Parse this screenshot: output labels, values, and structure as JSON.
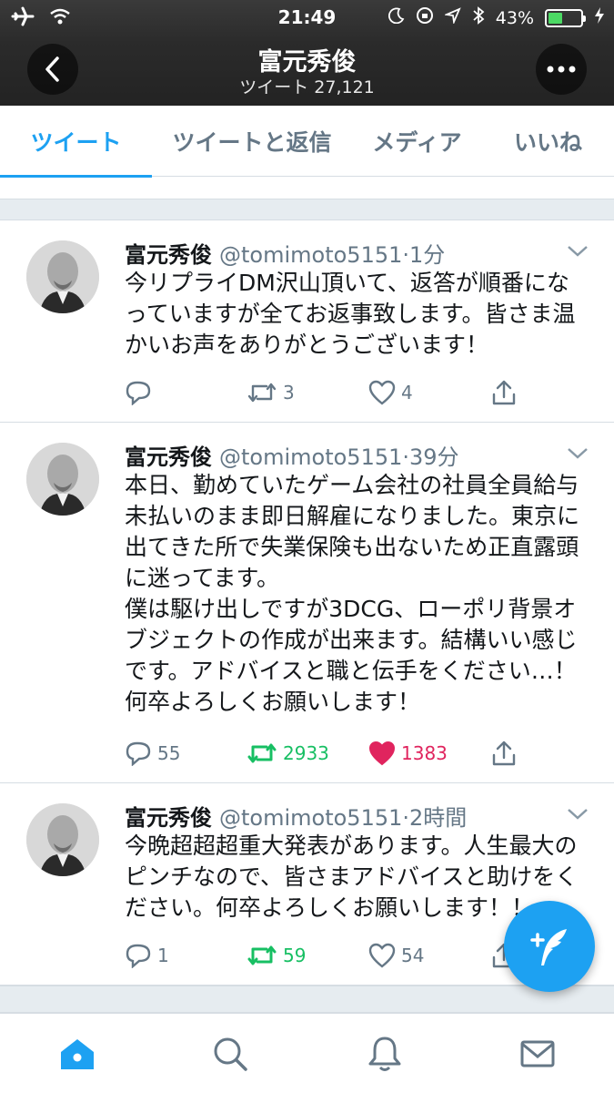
{
  "status_bar": {
    "time": "21:49",
    "battery": "43%",
    "battery_level": 0.43,
    "icons": [
      "airplane-icon",
      "wifi-icon",
      "moon-icon",
      "rotation-lock-icon",
      "location-icon",
      "bluetooth-icon",
      "battery-icon",
      "charging-icon"
    ]
  },
  "header": {
    "name": "富元秀俊",
    "subtitle": "ツイート 27,121",
    "back_icon": "chevron-left-icon",
    "more_icon": "more-dots-icon"
  },
  "tabs": [
    {
      "label": "ツイート",
      "active": true
    },
    {
      "label": "ツイートと返信",
      "active": false
    },
    {
      "label": "メディア",
      "active": false
    },
    {
      "label": "いいね",
      "active": false
    }
  ],
  "tweets": [
    {
      "name": "富元秀俊",
      "handle": "@tomimoto5151",
      "time": "·1分",
      "text": "今リプライDM沢山頂いて、返答が順番にな\nっていますが全てお返事致します。皆さま温\nかいお声をありがとうございます！",
      "replies": "",
      "retweets": "3",
      "likes": "4",
      "retweeted": false,
      "liked": false
    },
    {
      "name": "富元秀俊",
      "handle": "@tomimoto5151",
      "time": "·39分",
      "text": "本日、勤めていたゲーム会社の社員全員給与\n未払いのまま即日解雇になりました。東京に\n出てきた所で失業保険も出ないため正直露頭\nに迷ってます。\n僕は駆け出しですが3DCG、ローポリ背景オ\nブジェクトの作成が出来ます。結構いい感じ\nです。アドバイスと職と伝手をください…！\n何卒よろしくお願いします！",
      "replies": "55",
      "retweets": "2933",
      "likes": "1383",
      "retweeted": true,
      "liked": true
    },
    {
      "name": "富元秀俊",
      "handle": "@tomimoto5151",
      "time": "·2時間",
      "text": "今晩超超超重大発表があります。人生最大の\nピンチなので、皆さまアドバイスと助けをく\nださい。何卒よろしくお願いします！！",
      "replies": "1",
      "retweets": "59",
      "likes": "54",
      "retweeted": true,
      "liked": false
    }
  ],
  "tab_bar": [
    {
      "icon": "home-icon",
      "active": true
    },
    {
      "icon": "search-icon",
      "active": false
    },
    {
      "icon": "bell-icon",
      "active": false
    },
    {
      "icon": "mail-icon",
      "active": false
    }
  ],
  "colors": {
    "accent": "#1da1f2",
    "retweet": "#17bf63",
    "like": "#e0245e",
    "secondary_text": "#657786"
  }
}
